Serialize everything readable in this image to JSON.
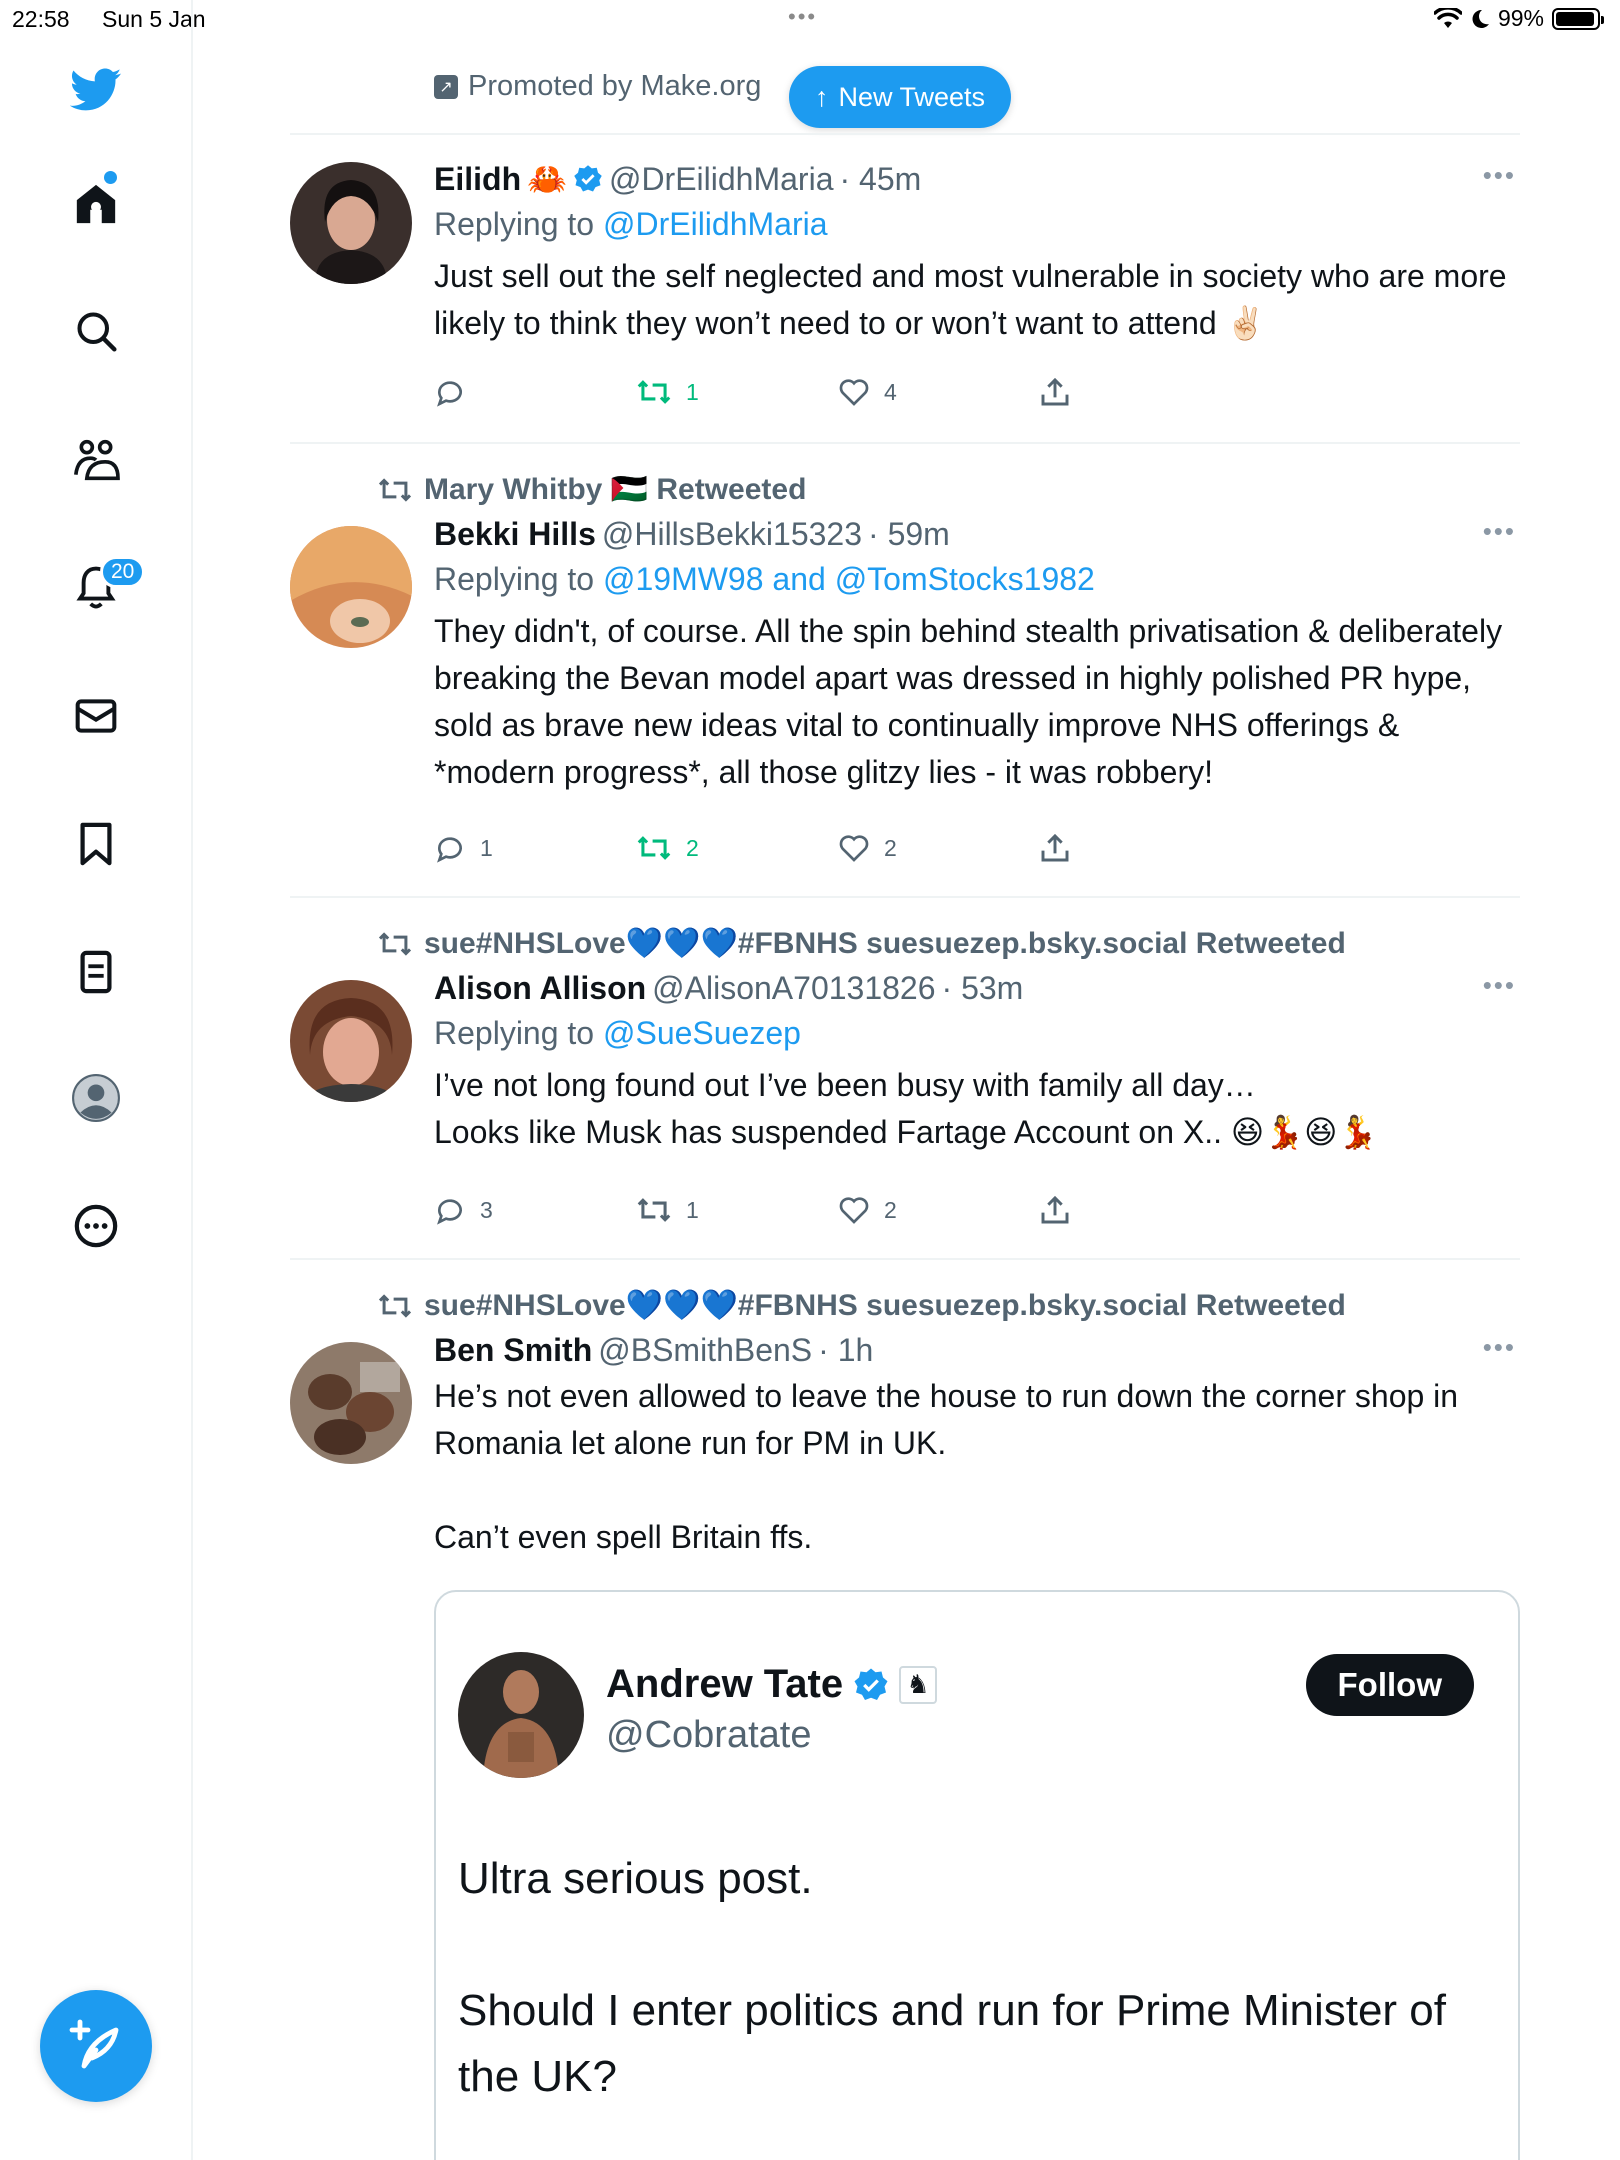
{
  "status_bar": {
    "time": "22:58",
    "date": "Sun 5 Jan",
    "battery": "99%",
    "battery_level": 0.99
  },
  "sidebar": {
    "notifications_badge": "20",
    "items": [
      {
        "icon": "home-icon"
      },
      {
        "icon": "search-icon"
      },
      {
        "icon": "communities-icon"
      },
      {
        "icon": "notifications-icon"
      },
      {
        "icon": "messages-icon"
      },
      {
        "icon": "bookmarks-icon"
      },
      {
        "icon": "lists-icon"
      },
      {
        "icon": "profile-icon"
      },
      {
        "icon": "more-icon"
      }
    ]
  },
  "feed": {
    "promoted": "Promoted by Make.org",
    "new_tweets_label": "New Tweets",
    "tweets": [
      {
        "name": "Eilidh",
        "name_emoji": "🦀",
        "verified": true,
        "handle": "@DrEilidhMaria",
        "time": "· 45m",
        "replying_prefix": "Replying to ",
        "replying_to": "@DrEilidhMaria",
        "text": "Just sell out the self neglected and most vulnerable in society who are more likely to think they won’t need to or won’t want to attend ✌🏻",
        "replies": "",
        "retweets": "1",
        "likes": "4"
      },
      {
        "retweeted_by": "Mary Whitby 🇵🇸 Retweeted",
        "name": "Bekki Hills",
        "handle": "@HillsBekki15323",
        "time": "· 59m",
        "replying_prefix": "Replying to ",
        "replying_to": "@19MW98 and @TomStocks1982",
        "text": "They didn't, of course. All the spin behind stealth privatisation & deliberately breaking the Bevan model apart was dressed in highly polished PR hype, sold as brave new ideas vital to continually improve NHS offerings & *modern progress*, all those glitzy lies - it was robbery!",
        "replies": "1",
        "retweets": "2",
        "likes": "2"
      },
      {
        "retweeted_by": "sue#NHSLove💙💙💙#FBNHS suesuezep.bsky.social Retweeted",
        "name": "Alison Allison",
        "handle": "@AlisonA70131826",
        "time": "· 53m",
        "replying_prefix": "Replying to ",
        "replying_to": "@SueSuezep",
        "text": "I’ve not long found out I’ve been busy with family all day…\nLooks like Musk has suspended Fartage Account on X.. 😆💃😆💃",
        "replies": "3",
        "retweets": "1",
        "likes": "2"
      },
      {
        "retweeted_by": "sue#NHSLove💙💙💙#FBNHS suesuezep.bsky.social Retweeted",
        "name": "Ben Smith",
        "handle": "@BSmithBenS",
        "time": "· 1h",
        "text": "He’s not even allowed to leave the house to run down the corner shop in Romania let alone run for PM in UK.\n\nCan’t even spell Britain ffs.",
        "quote": {
          "name": "Andrew Tate",
          "handle": "@Cobratate",
          "follow_label": "Follow",
          "text": "Ultra serious post.\n\nShould I enter politics and run for Prime Minister of the UK?"
        }
      }
    ]
  },
  "colors": {
    "accent": "#1d9bf0",
    "retweet_green": "#00ba7c",
    "secondary_text": "#536471"
  }
}
